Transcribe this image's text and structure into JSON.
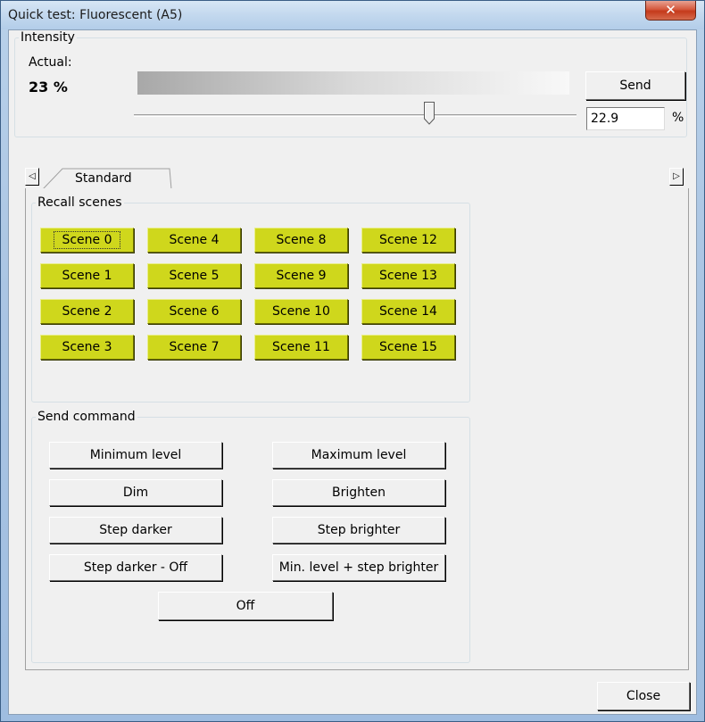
{
  "window": {
    "title": "Quick test: Fluorescent (A5)",
    "close_icon": "x-icon"
  },
  "intensity": {
    "group_label": "Intensity",
    "actual_label": "Actual:",
    "actual_value": "23 %",
    "send_label": "Send",
    "input_value": "22.9",
    "unit": "%",
    "slider_percent": 22.9
  },
  "tabs": {
    "active": "Standard",
    "left_arrow_icon": "triangle-left-icon",
    "right_arrow_icon": "triangle-right-icon"
  },
  "recall": {
    "group_label": "Recall scenes",
    "scenes": [
      [
        "Scene 0",
        "Scene 4",
        "Scene 8",
        "Scene 12"
      ],
      [
        "Scene 1",
        "Scene 5",
        "Scene 9",
        "Scene 13"
      ],
      [
        "Scene 2",
        "Scene 6",
        "Scene 10",
        "Scene 14"
      ],
      [
        "Scene 3",
        "Scene 7",
        "Scene 11",
        "Scene 15"
      ]
    ]
  },
  "commands": {
    "group_label": "Send command",
    "min_level": "Minimum level",
    "max_level": "Maximum level",
    "dim": "Dim",
    "brighten": "Brighten",
    "step_darker": "Step darker",
    "step_brighter": "Step brighter",
    "step_darker_off": "Step darker - Off",
    "min_step_brighter": "Min. level + step brighter",
    "off": "Off"
  },
  "footer": {
    "close_label": "Close"
  },
  "colors": {
    "scene_button": "#cfd71c",
    "dialog_bg": "#f0f0f0"
  }
}
